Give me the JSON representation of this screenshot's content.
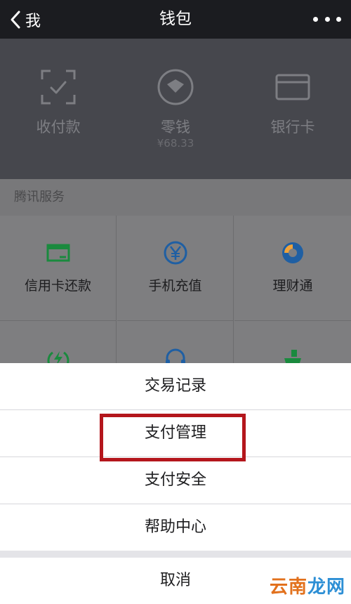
{
  "navbar": {
    "back_label": "我",
    "title": "钱包",
    "more_icon": "more-icon"
  },
  "wallet": {
    "items": [
      {
        "label": "收付款",
        "icon": "scan-pay-icon"
      },
      {
        "label": "零钱",
        "sub": "¥68.33",
        "icon": "change-wallet-icon"
      },
      {
        "label": "银行卡",
        "icon": "bank-card-icon"
      }
    ]
  },
  "services": {
    "title": "腾讯服务",
    "items": [
      {
        "label": "信用卡还款",
        "icon": "credit-card-icon",
        "color": "#1a8a3e"
      },
      {
        "label": "手机充值",
        "icon": "yen-icon",
        "color": "#1f5fa3"
      },
      {
        "label": "理财通",
        "icon": "licaitong-icon",
        "color": "#1f5fa3"
      },
      {
        "icon": "lightning-icon",
        "color": "#1a8a3e"
      },
      {
        "icon": "headset-icon",
        "color": "#1f5fa3"
      },
      {
        "icon": "cart-icon",
        "color": "#1a8a3e"
      }
    ]
  },
  "action_sheet": {
    "items": [
      {
        "label": "交易记录"
      },
      {
        "label": "支付管理",
        "highlighted": true
      },
      {
        "label": "支付安全"
      },
      {
        "label": "帮助中心"
      }
    ],
    "cancel_label": "取消",
    "highlight_color": "#b4161c"
  },
  "watermark": {
    "part1": "云南",
    "part2": "龙网"
  }
}
